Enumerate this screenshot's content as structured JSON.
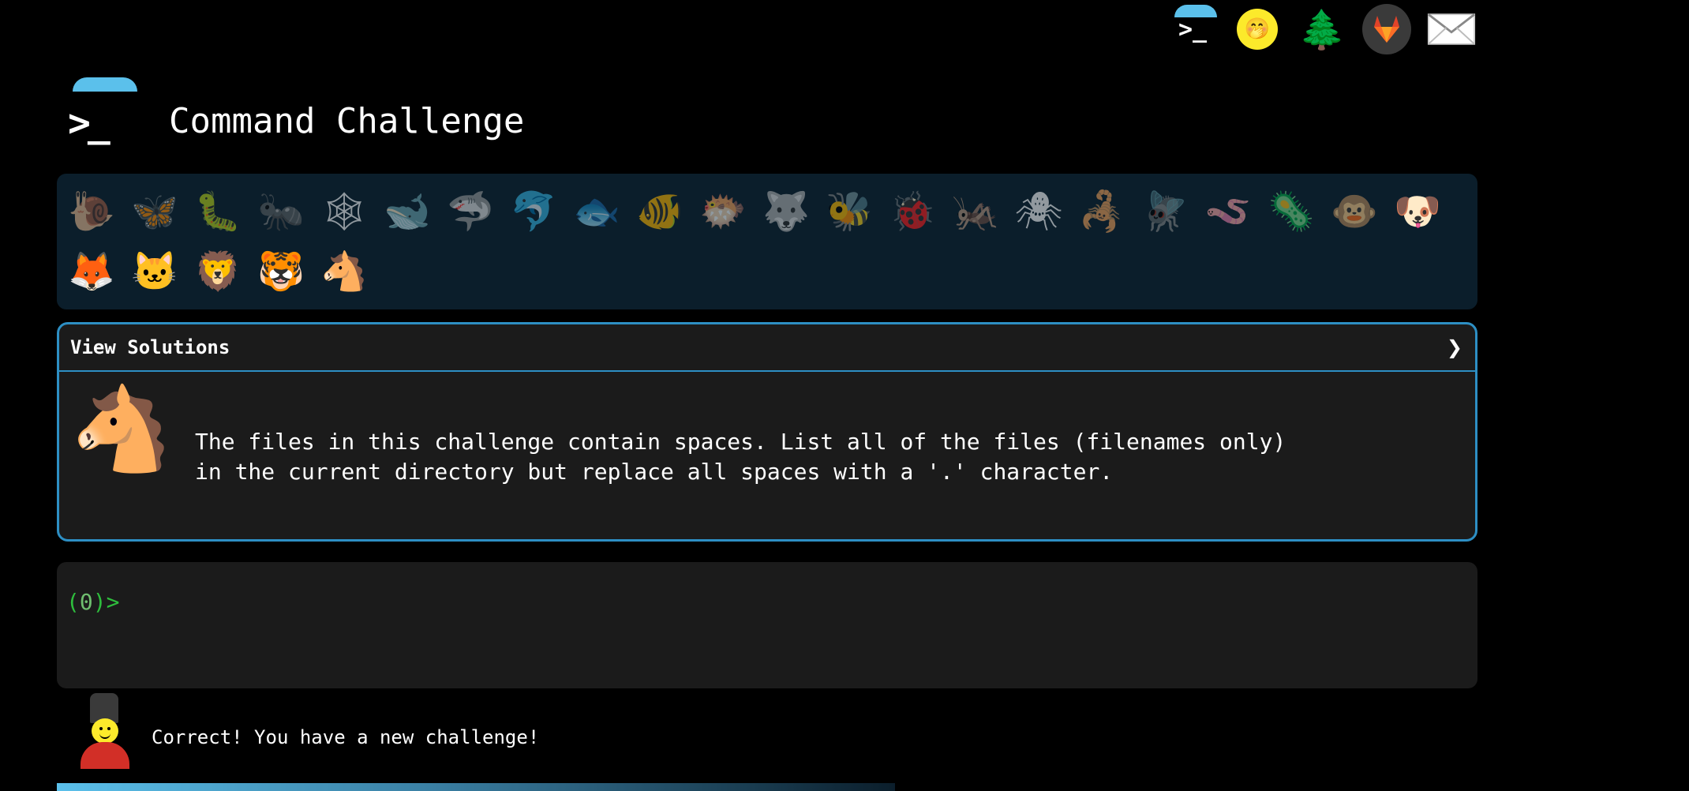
{
  "topnav": {
    "items": [
      {
        "name": "terminal",
        "glyph": ">_"
      },
      {
        "name": "face-with-hand-over-mouth",
        "glyph": "🤭"
      },
      {
        "name": "tree",
        "glyph": "🌲"
      },
      {
        "name": "gitlab",
        "glyph": "🦊"
      },
      {
        "name": "mail",
        "glyph": "✉"
      }
    ]
  },
  "header": {
    "logo_glyph": ">_",
    "title": "Command Challenge"
  },
  "animals": [
    {
      "name": "snail",
      "glyph": "🐌",
      "dim": true
    },
    {
      "name": "butterfly",
      "glyph": "🦋",
      "dim": true
    },
    {
      "name": "caterpillar",
      "glyph": "🐛",
      "dim": true
    },
    {
      "name": "ant",
      "glyph": "🐜",
      "dim": true
    },
    {
      "name": "spider-web",
      "glyph": "🕸",
      "dim": true
    },
    {
      "name": "whale",
      "glyph": "🐋",
      "dim": true
    },
    {
      "name": "shark",
      "glyph": "🦈",
      "dim": true
    },
    {
      "name": "dolphin",
      "glyph": "🐬",
      "dim": true
    },
    {
      "name": "fish",
      "glyph": "🐟",
      "dim": true
    },
    {
      "name": "tropical-fish",
      "glyph": "🐠",
      "dim": true
    },
    {
      "name": "blowfish",
      "glyph": "🐡",
      "dim": true
    },
    {
      "name": "wolf",
      "glyph": "🐺",
      "dim": true
    },
    {
      "name": "bee",
      "glyph": "🐝",
      "dim": true
    },
    {
      "name": "lady-beetle",
      "glyph": "🐞",
      "dim": true
    },
    {
      "name": "cricket",
      "glyph": "🦗",
      "dim": true
    },
    {
      "name": "spider",
      "glyph": "🕷",
      "dim": true
    },
    {
      "name": "scorpion",
      "glyph": "🦂",
      "dim": true
    },
    {
      "name": "fly",
      "glyph": "🪰",
      "dim": true
    },
    {
      "name": "worm",
      "glyph": "🪱",
      "dim": true
    },
    {
      "name": "microbe",
      "glyph": "🦠",
      "dim": true
    },
    {
      "name": "monkey",
      "glyph": "🐵",
      "dim": true
    },
    {
      "name": "dog",
      "glyph": "🐶",
      "dim": false
    },
    {
      "name": "fox",
      "glyph": "🦊",
      "dim": false
    },
    {
      "name": "cat",
      "glyph": "🐱",
      "dim": false
    },
    {
      "name": "lion",
      "glyph": "🦁",
      "dim": false
    },
    {
      "name": "tiger",
      "glyph": "🐯",
      "dim": false
    },
    {
      "name": "horse",
      "glyph": "🐴",
      "dim": false
    }
  ],
  "challenge": {
    "toggle_label": "View Solutions",
    "toggle_chevron": "❯",
    "animal_glyph": "🐴",
    "description_line1": "The files in this challenge contain spaces. List all of the files (filenames only)",
    "description_line2": "in the current directory but replace all spaces with a '.' character."
  },
  "terminal": {
    "prompt_open": "(",
    "prompt_code": "0",
    "prompt_close": ")>"
  },
  "status": {
    "message": "Correct! You have a new challenge!"
  },
  "progress": {
    "fraction": 0.59
  }
}
